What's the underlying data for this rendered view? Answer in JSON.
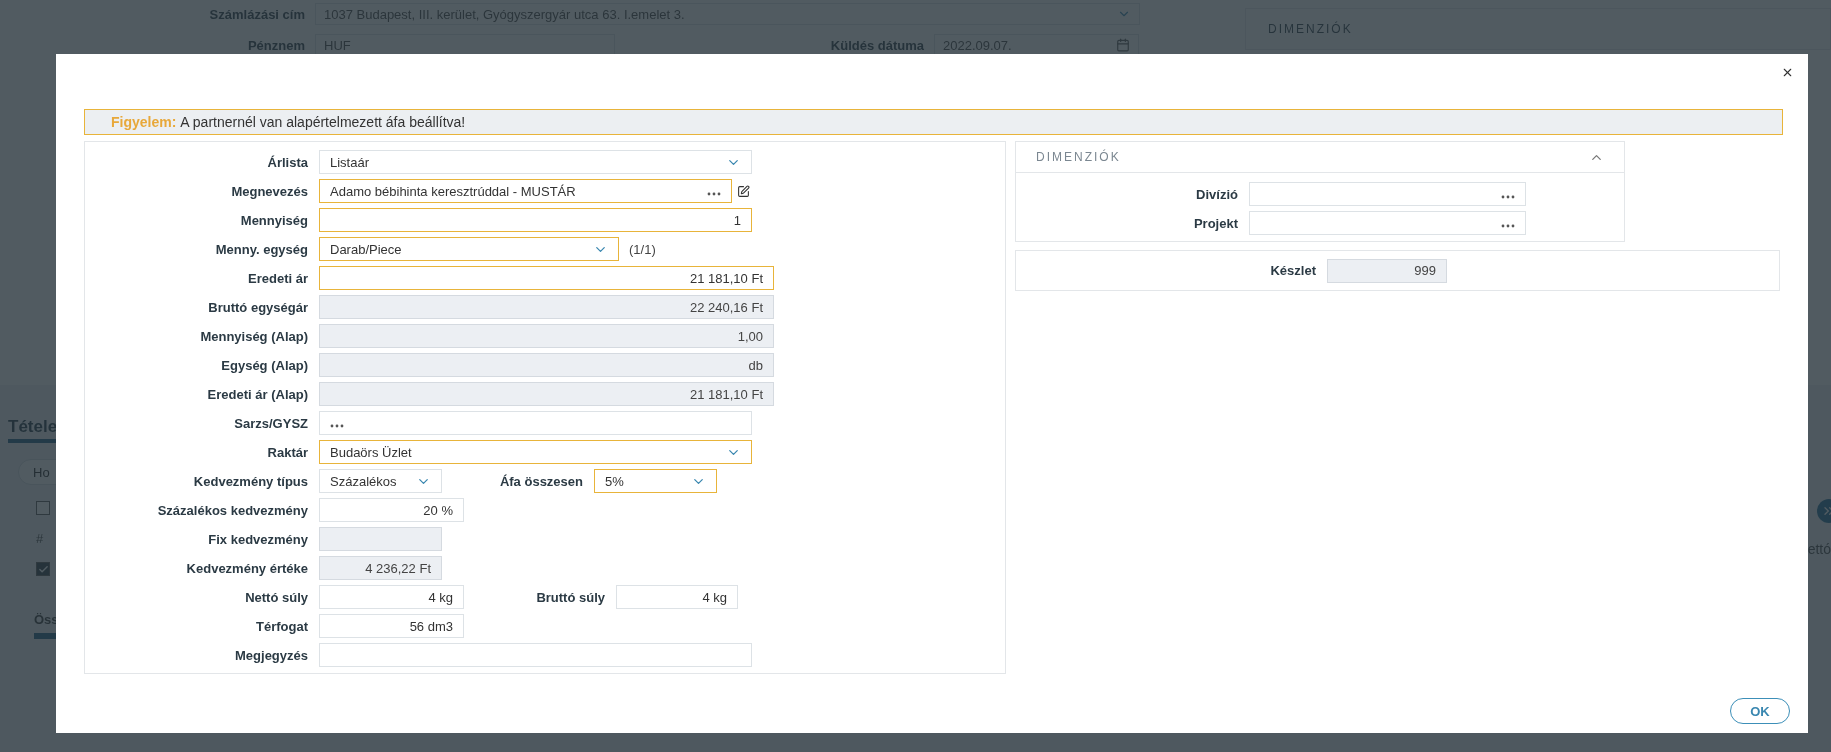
{
  "background": {
    "billing_label": "Számlázási cím",
    "billing_value": "1037 Budapest, III. kerület, Gyógyszergyár utca 63. I.emelet 3.",
    "currency_label": "Pénznem",
    "currency_value": "HUF",
    "send_date_label": "Küldés dátuma",
    "send_date_value": "2022.09.07.",
    "dimensions_title": "DIMENZIÓK",
    "items_title": "Tétele",
    "search_placeholder": "Ho",
    "checkboxes": [
      {
        "checked": false
      },
      {
        "checked": true
      }
    ],
    "hash_header": "#",
    "summary_label": "Öss",
    "net_header": "ettó"
  },
  "modal": {
    "warning": {
      "title": "Figyelem:",
      "text": "A partnernél van alapértelmezett áfa beállítva!"
    },
    "rows": [
      {
        "fields": [
          {
            "label": "Árlista",
            "value": "Listaár",
            "kind": "select",
            "highlighted": false
          }
        ]
      },
      {
        "fields": [
          {
            "label": "Megnevezés",
            "value": "Adamo bébihinta keresztrúddal - MUSTÁR",
            "kind": "lookup",
            "highlighted": true,
            "editable": true
          }
        ]
      },
      {
        "fields": [
          {
            "label": "Mennyiség",
            "value": "1",
            "kind": "number",
            "highlighted": true
          }
        ]
      },
      {
        "fields": [
          {
            "label": "Menny. egység",
            "value": "Darab/Piece",
            "kind": "select",
            "highlighted": true
          }
        ],
        "note": "(1/1)"
      },
      {
        "fields": [
          {
            "label": "Eredeti ár",
            "value": "21 181,10 Ft",
            "kind": "number",
            "highlighted": true
          }
        ]
      },
      {
        "fields": [
          {
            "label": "Bruttó egységár",
            "value": "22 240,16 Ft",
            "kind": "readonly",
            "highlighted": false
          }
        ]
      },
      {
        "fields": [
          {
            "label": "Mennyiség (Alap)",
            "value": "1,00",
            "kind": "readonly",
            "highlighted": false
          }
        ]
      },
      {
        "fields": [
          {
            "label": "Egység (Alap)",
            "value": "db",
            "kind": "readonly",
            "highlighted": false
          }
        ]
      },
      {
        "fields": [
          {
            "label": "Eredeti ár (Alap)",
            "value": "21 181,10 Ft",
            "kind": "readonly",
            "highlighted": false
          }
        ]
      },
      {
        "fields": [
          {
            "label": "Sarzs/GYSZ",
            "kind": "lookup",
            "highlighted": false
          }
        ]
      },
      {
        "fields": [
          {
            "label": "Raktár",
            "value": "Budaörs Üzlet",
            "kind": "select",
            "highlighted": true
          }
        ]
      },
      {
        "fields": [
          {
            "label": "Kedvezmény típus",
            "value": "Százalékos",
            "kind": "select",
            "highlighted": false
          },
          {
            "label": "Áfa összesen",
            "value": "5%",
            "kind": "select",
            "highlighted": true
          }
        ]
      },
      {
        "fields": [
          {
            "label": "Százalékos kedvezmény",
            "value": "20 %",
            "kind": "number",
            "highlighted": false
          }
        ]
      },
      {
        "fields": [
          {
            "label": "Fix kedvezmény",
            "kind": "readonly",
            "highlighted": false
          }
        ]
      },
      {
        "fields": [
          {
            "label": "Kedvezmény értéke",
            "value": "4 236,22 Ft",
            "kind": "readonly",
            "highlighted": false
          }
        ]
      },
      {
        "fields": [
          {
            "label": "Nettó súly",
            "value": "4 kg",
            "kind": "number",
            "highlighted": false
          },
          {
            "label": "Bruttó súly",
            "value": "4 kg",
            "kind": "number",
            "highlighted": false
          }
        ]
      },
      {
        "fields": [
          {
            "label": "Térfogat",
            "value": "56 dm3",
            "kind": "number",
            "highlighted": false
          }
        ]
      },
      {
        "fields": [
          {
            "label": "Megjegyzés",
            "kind": "text",
            "highlighted": false
          }
        ]
      }
    ],
    "dimensions": {
      "title": "DIMENZIÓK",
      "expanded": true,
      "fields": [
        {
          "label": "Divízió"
        },
        {
          "label": "Projekt"
        }
      ]
    },
    "stock": {
      "label": "Készlet",
      "value": "999"
    },
    "ok_button": "OK"
  }
}
